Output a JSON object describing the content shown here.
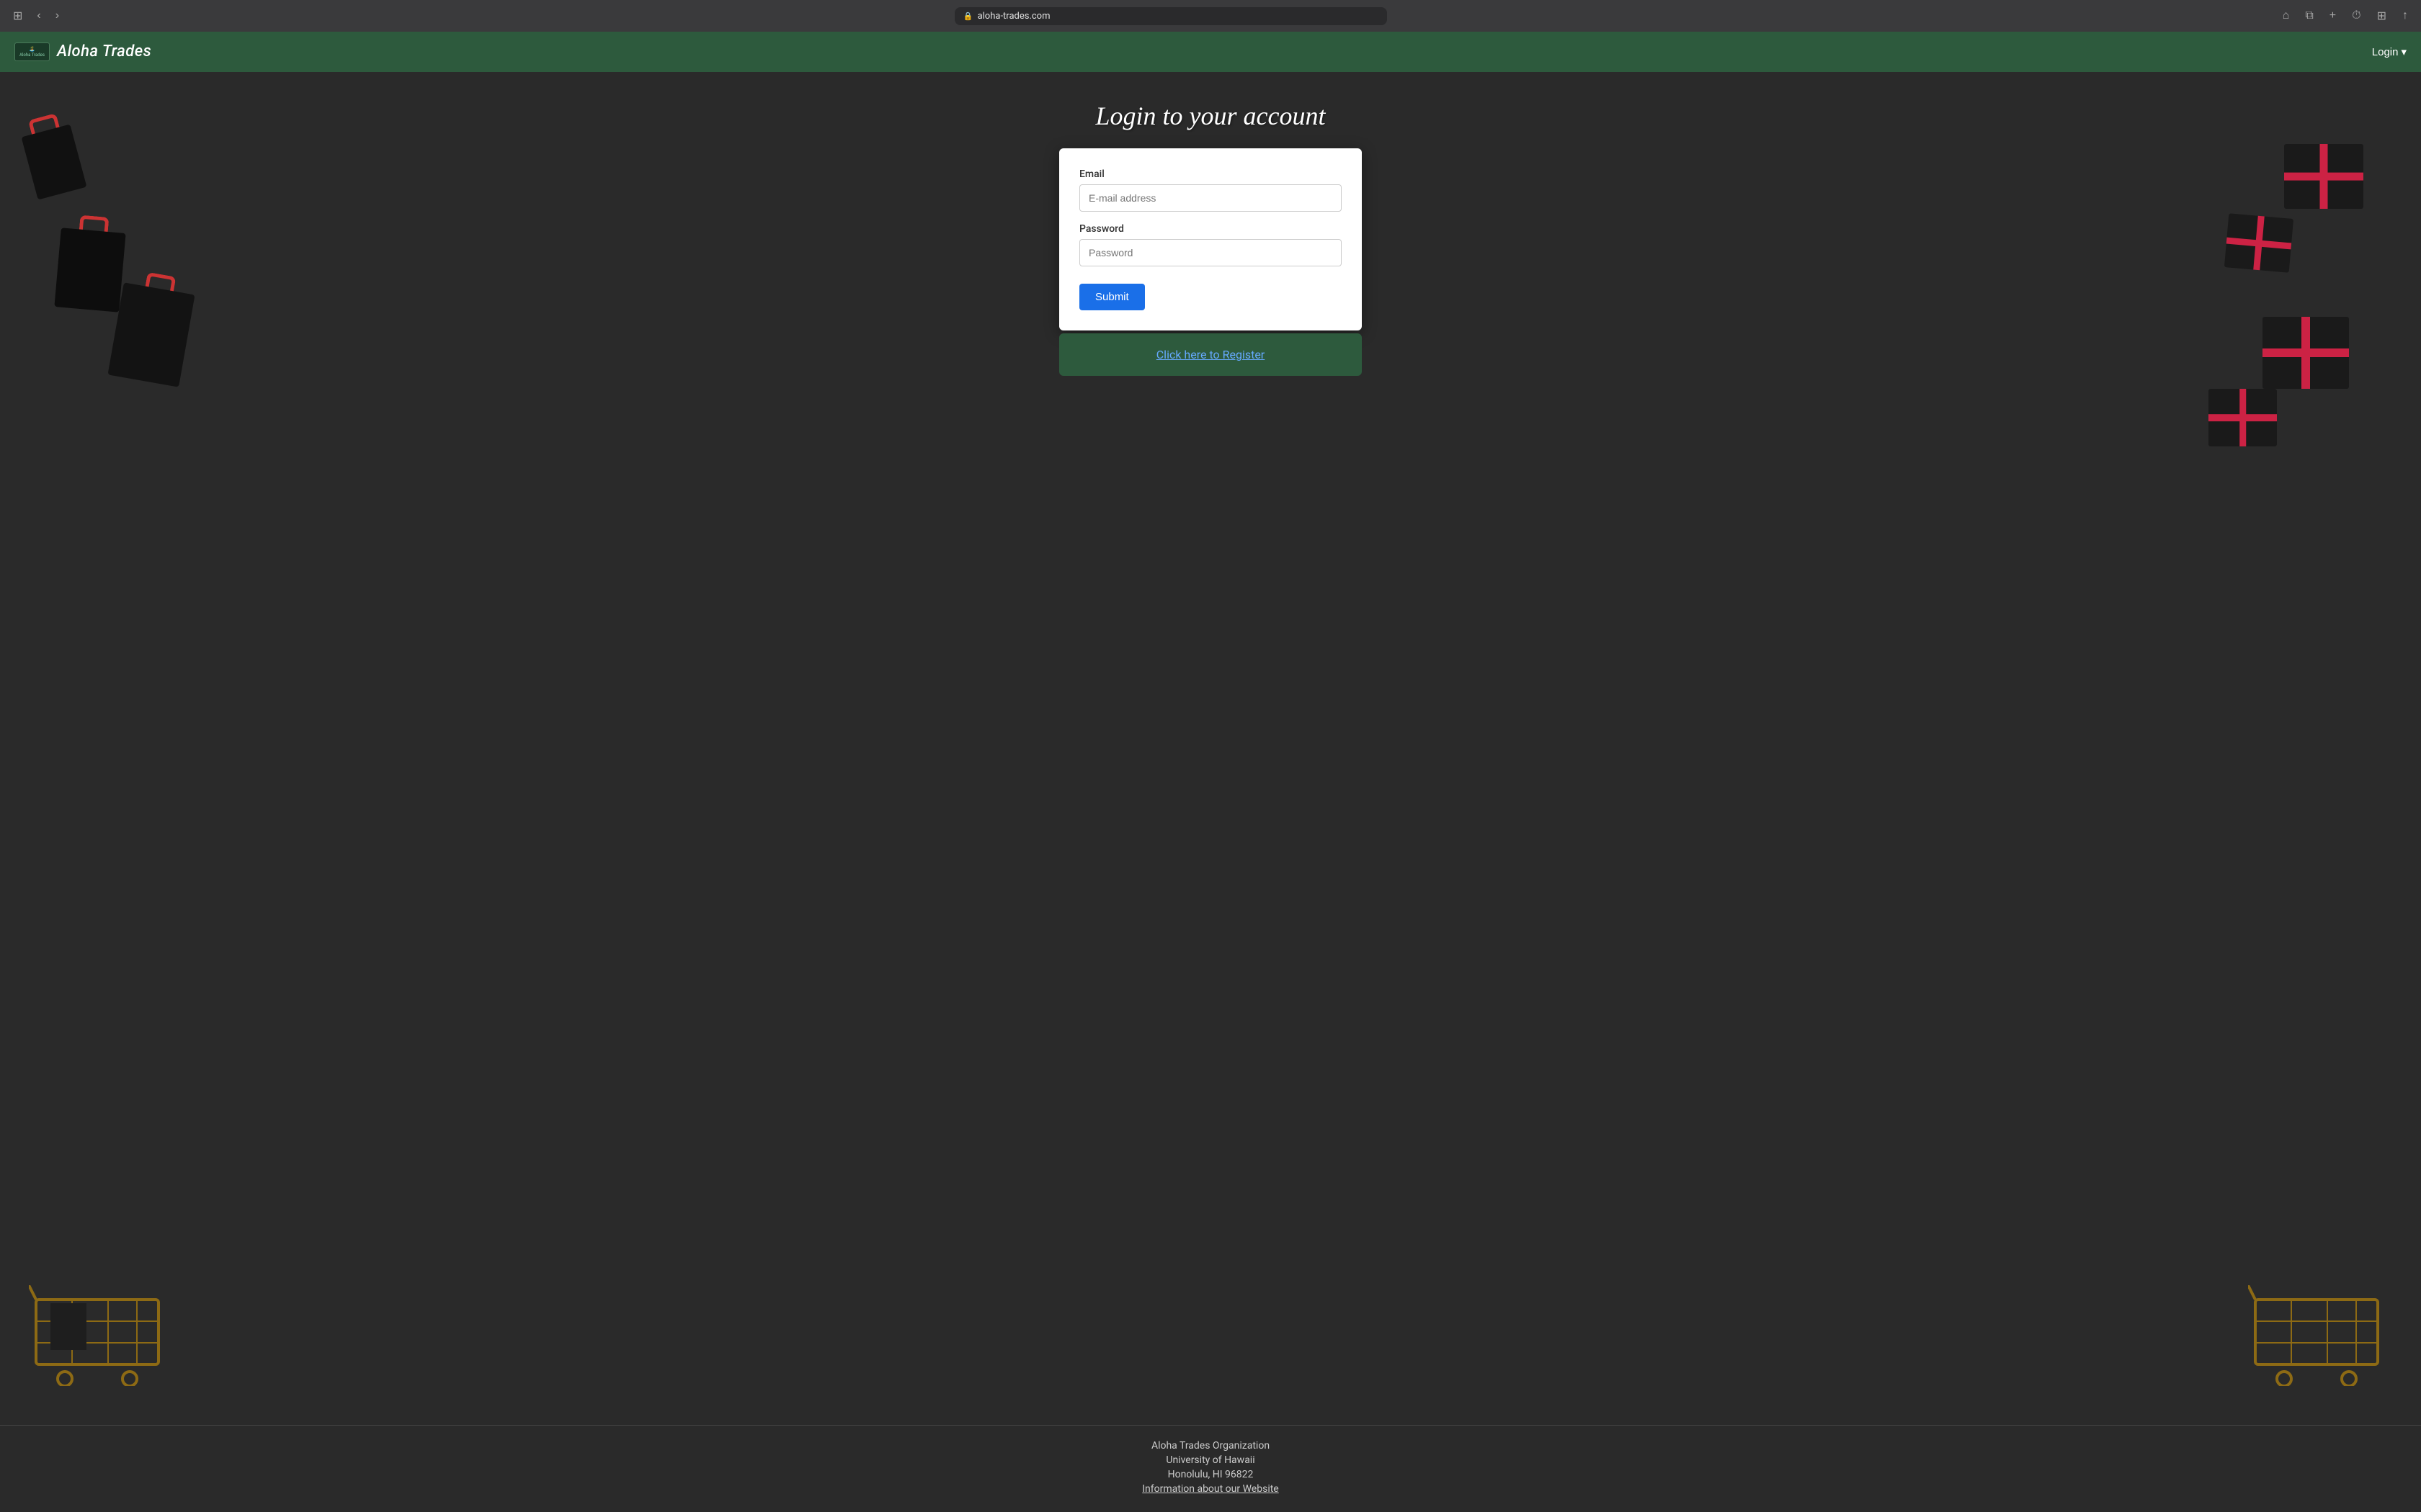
{
  "browser": {
    "url": "aloha-trades.com",
    "lock_icon": "🔒"
  },
  "navbar": {
    "brand_logo_line1": "Aloha Trades",
    "brand_name": "Aloha Trades",
    "login_label": "Login"
  },
  "page": {
    "title": "Login to your account",
    "email_label": "Email",
    "email_placeholder": "E-mail address",
    "password_label": "Password",
    "password_placeholder": "Password",
    "submit_label": "Submit",
    "register_label": "Click here to Register"
  },
  "footer": {
    "org_name": "Aloha Trades Organization",
    "university": "University of Hawaii",
    "address": "Honolulu, HI 96822",
    "info_link": "Information about our Website"
  }
}
